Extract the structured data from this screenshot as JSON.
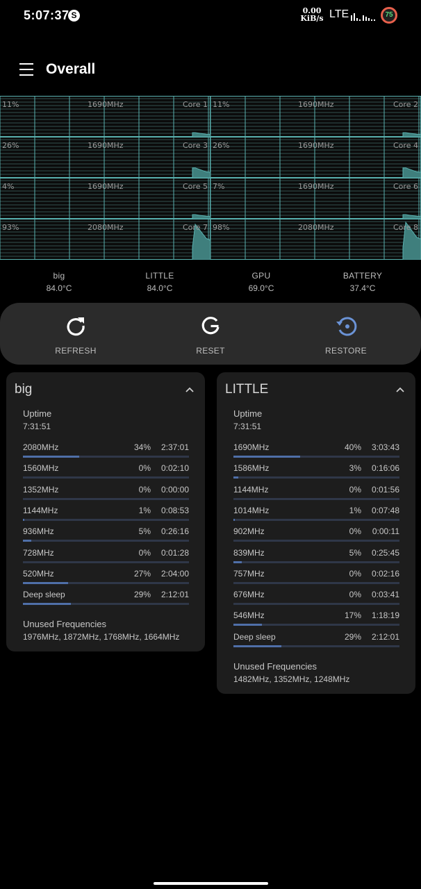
{
  "status_bar": {
    "time": "5:07:37",
    "speed_value": "0.00",
    "speed_unit": "KiB/s",
    "network": "LTE",
    "battery_level": "75",
    "notification_icon": "s-circle-icon"
  },
  "app_bar": {
    "title": "Overall",
    "menu_icon": "hamburger-menu-icon"
  },
  "cores": [
    {
      "name": "Core 1",
      "load": "11%",
      "freq": "1690MHz"
    },
    {
      "name": "Core 2",
      "load": "11%",
      "freq": "1690MHz"
    },
    {
      "name": "Core 3",
      "load": "26%",
      "freq": "1690MHz"
    },
    {
      "name": "Core 4",
      "load": "26%",
      "freq": "1690MHz"
    },
    {
      "name": "Core 5",
      "load": "4%",
      "freq": "1690MHz"
    },
    {
      "name": "Core 6",
      "load": "7%",
      "freq": "1690MHz"
    },
    {
      "name": "Core 7",
      "load": "93%",
      "freq": "2080MHz"
    },
    {
      "name": "Core 8",
      "load": "98%",
      "freq": "2080MHz"
    }
  ],
  "temperatures": [
    {
      "name": "big",
      "value": "84.0°C"
    },
    {
      "name": "LITTLE",
      "value": "84.0°C"
    },
    {
      "name": "GPU",
      "value": "69.0°C"
    },
    {
      "name": "BATTERY",
      "value": "37.4°C"
    }
  ],
  "actions": [
    {
      "label": "REFRESH",
      "icon": "refresh-icon"
    },
    {
      "label": "RESET",
      "icon": "reset-icon"
    },
    {
      "label": "RESTORE",
      "icon": "restore-icon"
    }
  ],
  "colors": {
    "graph_line": "#59b2b0",
    "graph_fill": "#3f7f7d",
    "progress_fill": "#4f6fa8",
    "progress_track": "#2f3748",
    "battery_ring": "#e8604c",
    "battery_text": "#5bd67c",
    "action_restore": "#6b93d6"
  },
  "clusters": [
    {
      "title": "big",
      "uptime_label": "Uptime",
      "uptime": "7:31:51",
      "rows": [
        {
          "freq": "2080MHz",
          "pct": "34%",
          "time": "2:37:01",
          "ratio": 0.34
        },
        {
          "freq": "1560MHz",
          "pct": "0%",
          "time": "0:02:10",
          "ratio": 0.0
        },
        {
          "freq": "1352MHz",
          "pct": "0%",
          "time": "0:00:00",
          "ratio": 0.0
        },
        {
          "freq": "1144MHz",
          "pct": "1%",
          "time": "0:08:53",
          "ratio": 0.01
        },
        {
          "freq": "936MHz",
          "pct": "5%",
          "time": "0:26:16",
          "ratio": 0.05
        },
        {
          "freq": "728MHz",
          "pct": "0%",
          "time": "0:01:28",
          "ratio": 0.0
        },
        {
          "freq": "520MHz",
          "pct": "27%",
          "time": "2:04:00",
          "ratio": 0.27
        },
        {
          "freq": "Deep sleep",
          "pct": "29%",
          "time": "2:12:01",
          "ratio": 0.29
        }
      ],
      "unused_label": "Unused Frequencies",
      "unused": "1976MHz, 1872MHz, 1768MHz, 1664MHz"
    },
    {
      "title": "LITTLE",
      "uptime_label": "Uptime",
      "uptime": "7:31:51",
      "rows": [
        {
          "freq": "1690MHz",
          "pct": "40%",
          "time": "3:03:43",
          "ratio": 0.4
        },
        {
          "freq": "1586MHz",
          "pct": "3%",
          "time": "0:16:06",
          "ratio": 0.03
        },
        {
          "freq": "1144MHz",
          "pct": "0%",
          "time": "0:01:56",
          "ratio": 0.0
        },
        {
          "freq": "1014MHz",
          "pct": "1%",
          "time": "0:07:48",
          "ratio": 0.01
        },
        {
          "freq": "902MHz",
          "pct": "0%",
          "time": "0:00:11",
          "ratio": 0.0
        },
        {
          "freq": "839MHz",
          "pct": "5%",
          "time": "0:25:45",
          "ratio": 0.05
        },
        {
          "freq": "757MHz",
          "pct": "0%",
          "time": "0:02:16",
          "ratio": 0.0
        },
        {
          "freq": "676MHz",
          "pct": "0%",
          "time": "0:03:41",
          "ratio": 0.0
        },
        {
          "freq": "546MHz",
          "pct": "17%",
          "time": "1:18:19",
          "ratio": 0.17
        },
        {
          "freq": "Deep sleep",
          "pct": "29%",
          "time": "2:12:01",
          "ratio": 0.29
        }
      ],
      "unused_label": "Unused Frequencies",
      "unused": "1482MHz, 1352MHz, 1248MHz"
    }
  ]
}
